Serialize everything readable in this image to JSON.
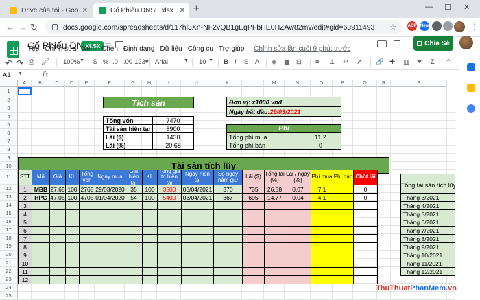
{
  "browser": {
    "tabs": [
      {
        "title": "Drive của tôi - Google Drive",
        "color": "#fbbc04"
      },
      {
        "title": "Cổ Phiếu DNSE.xlsx - Google Tra",
        "color": "#0f9d58"
      }
    ],
    "url": "docs.google.com/spreadsheets/d/117hl3Xn-NF2vQB1gEqPFbHE0HZAw82mv/edit#gid=63911493",
    "ext_badges": [
      "ABP",
      "New"
    ]
  },
  "sheets": {
    "title": "Cổ Phiếu DNSE",
    "badge": ".XLSX",
    "menu": [
      "Tệp",
      "Chỉnh sửa",
      "Xem",
      "Chèn",
      "Định dạng",
      "Dữ liệu",
      "Công cụ",
      "Trợ giúp"
    ],
    "last_edit": "Chỉnh sửa lần cuối 9 phút trước",
    "share_label": "Chia Sẻ",
    "toolbar": {
      "zoom": "100%",
      "currency": "$",
      "percent": "%",
      "decimals_less": ".0",
      "decimals_more": ".00",
      "format": "123▾",
      "font": "Arial",
      "size": "10",
      "bold": "B",
      "italic": "I",
      "strike": "S",
      "text_color": "A"
    },
    "namebox": "A1",
    "fx": "fx"
  },
  "grid": {
    "columns": [
      "A",
      "B",
      "C",
      "D",
      "E",
      "F",
      "G",
      "H",
      "I",
      "J",
      "K",
      "L",
      "M",
      "N",
      "O",
      "P",
      "Q",
      "R",
      "S"
    ],
    "rows": [
      "1",
      "2",
      "3",
      "4",
      "5",
      "6",
      "7",
      "8",
      "9",
      "10",
      "11",
      "12",
      "13",
      "14",
      "15",
      "16",
      "17",
      "18",
      "19",
      "20",
      "21",
      "22",
      "23",
      "24",
      "25"
    ]
  },
  "tai_san": {
    "header": "Tích sản",
    "rows": [
      {
        "label": "Tổng vốn",
        "value": "7470"
      },
      {
        "label": "Tài sản hiện tại",
        "value": "8900"
      },
      {
        "label": "Lãi ($)",
        "value": "1430"
      },
      {
        "label": "Lãi (%)",
        "value": "20,68"
      }
    ]
  },
  "info": {
    "unit": "Đơn vị: x1000 vnđ",
    "start_label": "Ngày bắt đầu: ",
    "start_date": "29/03/2021"
  },
  "phi": {
    "header": "Phí",
    "rows": [
      {
        "label": "Tổng phí mua",
        "value": "11,2"
      },
      {
        "label": "Tổng phí bán",
        "value": "0"
      }
    ]
  },
  "tai_san_tich_luy": {
    "title": "Tài sản tích lũy",
    "headers": [
      "STT",
      "Mã",
      "Giá",
      "KL",
      "Tổng vốn",
      "Ngày mua",
      "Giá hiện tại",
      "KL",
      "Tổng giá trị hiện tại",
      "Ngày hiện tại",
      "Số ngày nắm giữ",
      "Lãi ($)",
      "Tổng lãi (%)",
      "Lãi / ngày (%)",
      "Phí mua",
      "Phí bán",
      "Chốt lãi"
    ],
    "rows": [
      [
        "1",
        "MBB",
        "27,65",
        "100",
        "2765",
        "29/03/2020",
        "35",
        "100",
        "3500",
        "03/04/2021",
        "370",
        "735",
        "26,58",
        "0,07",
        "7,1",
        "",
        "0"
      ],
      [
        "2",
        "HPG",
        "47,05",
        "100",
        "4705",
        "01/04/2020",
        "54",
        "100",
        "5400",
        "03/04/2021",
        "367",
        "695",
        "14,77",
        "0,04",
        "4,1",
        "",
        "0"
      ],
      [
        "3"
      ],
      [
        "4"
      ],
      [
        "5"
      ],
      [
        "6"
      ],
      [
        "7"
      ],
      [
        "8"
      ],
      [
        "9"
      ],
      [
        "10"
      ],
      [
        "11"
      ],
      [
        "12"
      ]
    ]
  },
  "monthly": {
    "header": "Tổng tài sản tích lũy",
    "months": [
      "Tháng 3/2021",
      "Tháng 4/2021",
      "Tháng 5/2021",
      "Tháng 6/2021",
      "Tháng 7/2021",
      "Tháng 8/2021",
      "Tháng 9/2021",
      "Tháng 10/2021",
      "Tháng 11/2021",
      "Tháng 12/2021"
    ]
  },
  "watermark": {
    "a": "ThuThuat",
    "b": "PhanMem",
    "c": ".vn"
  }
}
